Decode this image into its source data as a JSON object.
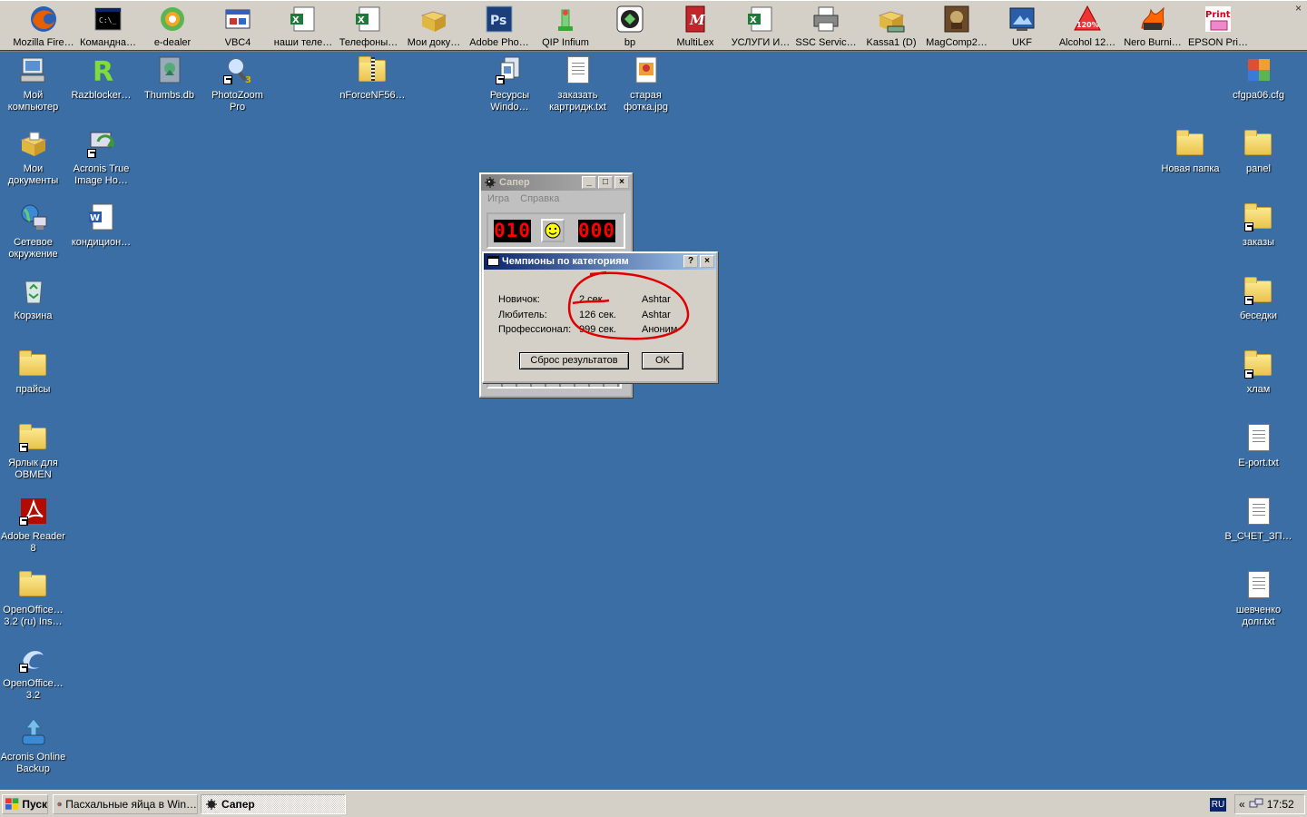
{
  "toolbar": {
    "close_glyph": "×",
    "items": [
      {
        "label": "Mozilla Fire…",
        "icon": "firefox-icon"
      },
      {
        "label": "Командна…",
        "icon": "cmd-icon"
      },
      {
        "label": "e-dealer",
        "icon": "e-dealer-icon"
      },
      {
        "label": "VBC4",
        "icon": "vbc4-icon"
      },
      {
        "label": "наши теле…",
        "icon": "excel-icon"
      },
      {
        "label": "Телефоны…",
        "icon": "excel-icon"
      },
      {
        "label": "Мои доку…",
        "icon": "documents-icon"
      },
      {
        "label": "Adobe Pho…",
        "icon": "photoshop-icon",
        "text": "Ps"
      },
      {
        "label": "QIP Infium",
        "icon": "qip-icon"
      },
      {
        "label": "bp",
        "icon": "bp-icon"
      },
      {
        "label": "MultiLex",
        "icon": "multilex-icon",
        "text": "M"
      },
      {
        "label": "УСЛУГИ И…",
        "icon": "excel-icon"
      },
      {
        "label": "SSC Servic…",
        "icon": "printer-icon"
      },
      {
        "label": "Kassa1 (D)",
        "icon": "drive-icon"
      },
      {
        "label": "MagComp2…",
        "icon": "magcomp-icon"
      },
      {
        "label": "UKF",
        "icon": "ukf-icon"
      },
      {
        "label": "Alcohol 12…",
        "icon": "alcohol-icon",
        "text": "120%"
      },
      {
        "label": "Nero Burni…",
        "icon": "nero-icon"
      },
      {
        "label": "EPSON Pri…",
        "icon": "epson-icon",
        "text": "Print"
      }
    ]
  },
  "desktop_left": [
    {
      "label": "Мой компьютер",
      "icon": "my-computer-icon"
    },
    {
      "label": "Razblocker…",
      "icon": "razblocker-icon",
      "text": "R"
    },
    {
      "label": "Thumbs.db",
      "icon": "thumbs-db-icon"
    },
    {
      "label": "PhotoZoom Pro",
      "icon": "photozoom-icon",
      "text": "3"
    },
    {
      "label": "nForceNF56…",
      "icon": "zip-folder-icon"
    },
    {
      "label": "Ресурсы Windo…",
      "icon": "resources-icon"
    },
    {
      "label": "заказать картридж.txt",
      "icon": "text-file-icon"
    },
    {
      "label": "старая фотка.jpg",
      "icon": "image-file-icon"
    },
    {
      "label": "Мои документы",
      "icon": "my-documents-icon"
    },
    {
      "label": "Acronis True Image Ho…",
      "icon": "acronis-icon"
    },
    {
      "label": "Сетевое окружение",
      "icon": "network-icon"
    },
    {
      "label": "кондицион…",
      "icon": "word-doc-icon",
      "text": "W"
    },
    {
      "label": "Корзина",
      "icon": "recycle-bin-icon"
    },
    {
      "label": "прайсы",
      "icon": "folder-icon"
    },
    {
      "label": "Ярлык для OBMEN",
      "icon": "folder-icon"
    },
    {
      "label": "Adobe Reader 8",
      "icon": "adobe-reader-icon"
    },
    {
      "label": "OpenOffice… 3.2 (ru) Ins…",
      "icon": "folder-icon"
    },
    {
      "label": "OpenOffice… 3.2",
      "icon": "openoffice-icon"
    },
    {
      "label": "Acronis Online Backup",
      "icon": "acronis-backup-icon"
    }
  ],
  "desktop_right": [
    {
      "label": "cfgpa06.cfg",
      "icon": "config-file-icon"
    },
    {
      "label": "Новая папка",
      "icon": "folder-icon"
    },
    {
      "label": "panel",
      "icon": "folder-icon"
    },
    {
      "label": "заказы",
      "icon": "folder-icon"
    },
    {
      "label": "беседки",
      "icon": "folder-icon"
    },
    {
      "label": "хлам",
      "icon": "folder-icon"
    },
    {
      "label": "E-port.txt",
      "icon": "text-file-icon"
    },
    {
      "label": "В_СЧЕТ_ЗП…",
      "icon": "text-file-icon"
    },
    {
      "label": "шевченко долг.txt",
      "icon": "text-file-icon"
    }
  ],
  "minesweeper": {
    "title": "Сапер",
    "menu": [
      "Игра",
      "Справка"
    ],
    "mines_left": "010",
    "timer": "000",
    "window_buttons": [
      "_",
      "□",
      "×"
    ]
  },
  "dialog": {
    "title": "Чемпионы по категориям",
    "help_glyph": "?",
    "close_glyph": "×",
    "rows": [
      {
        "category": "Новичок:",
        "time": "2 сек.",
        "name": "Ashtar"
      },
      {
        "category": "Любитель:",
        "time": "126 сек.",
        "name": "Ashtar"
      },
      {
        "category": "Профессионал:",
        "time": "999 сек.",
        "name": "Аноним"
      }
    ],
    "reset_label": "Сброс результатов",
    "ok_label": "OK",
    "annotation_color": "#e00000"
  },
  "taskbar": {
    "start_label": "Пуск",
    "tasks": [
      {
        "label": "Пасхальные яйца в Win…",
        "active": false
      },
      {
        "label": "Сапер",
        "active": true
      }
    ],
    "language": "RU",
    "tray_chevron": "«",
    "clock": "17:52"
  },
  "colors": {
    "desktop": "#3a6ea5",
    "titlebar_active": "#0a246a",
    "titlebar_inactive": "#808080",
    "lcd_digits": "#ff0000"
  }
}
